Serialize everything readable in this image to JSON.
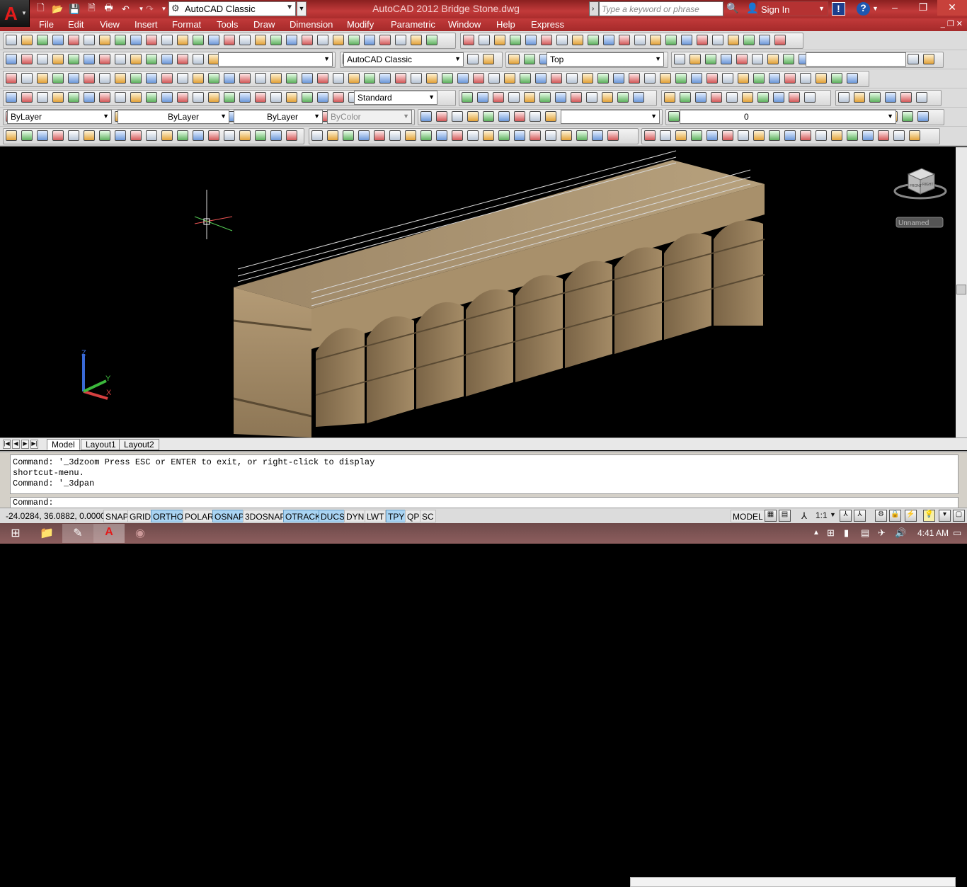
{
  "titlebar": {
    "title": "AutoCAD 2012    Bridge Stone.dwg",
    "workspace": "AutoCAD Classic",
    "search_placeholder": "Type a keyword or phrase",
    "sign_in": "Sign In"
  },
  "menu": [
    "File",
    "Edit",
    "View",
    "Insert",
    "Format",
    "Tools",
    "Draw",
    "Dimension",
    "Modify",
    "Parametric",
    "Window",
    "Help",
    "Express"
  ],
  "toolbar": {
    "workspace_select": "AutoCAD Classic",
    "view_select": "Top",
    "text_style": "Standard",
    "layer_color": "ByLayer",
    "linetype": "ByLayer",
    "lineweight": "ByLayer",
    "plot_style": "ByColor",
    "layer_name": "0"
  },
  "viewport": {
    "viewcube_label": "Unnamed",
    "ucs_x": "X",
    "ucs_y": "Y",
    "ucs_z": "Z",
    "cube_faces": [
      "FRONT",
      "RIGHT"
    ]
  },
  "layout_tabs": [
    "Model",
    "Layout1",
    "Layout2"
  ],
  "command": {
    "history": [
      "Command: '_3dzoom Press ESC or ENTER to exit, or right-click to display",
      "shortcut-menu.",
      "Command: '_3dpan"
    ],
    "prompt": "Command:"
  },
  "status": {
    "coords": "-24.0284, 36.0882, 0.0000",
    "toggles": [
      {
        "label": "SNAP",
        "on": false
      },
      {
        "label": "GRID",
        "on": false
      },
      {
        "label": "ORTHO",
        "on": true
      },
      {
        "label": "POLAR",
        "on": false
      },
      {
        "label": "OSNAP",
        "on": true
      },
      {
        "label": "3DOSNAP",
        "on": false
      },
      {
        "label": "OTRACK",
        "on": true
      },
      {
        "label": "DUCS",
        "on": true
      },
      {
        "label": "DYN",
        "on": false
      },
      {
        "label": "LWT",
        "on": false
      },
      {
        "label": "TPY",
        "on": true
      },
      {
        "label": "QP",
        "on": false
      },
      {
        "label": "SC",
        "on": false
      }
    ],
    "model_label": "MODEL",
    "scale": "1:1"
  },
  "taskbar": {
    "time": "4:41 AM"
  },
  "colors": {
    "title_red": "#c23a3a",
    "stone": "#a38c68",
    "background": "#000000"
  }
}
